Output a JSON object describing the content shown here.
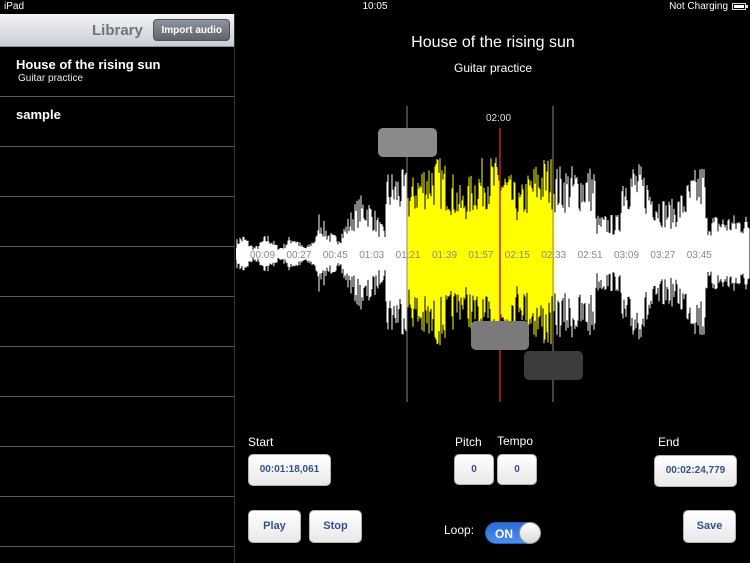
{
  "status": {
    "device": "iPad",
    "time": "10:05",
    "battery": "Not Charging"
  },
  "sidebar": {
    "title": "Library",
    "import_label": "Import audio",
    "items": [
      {
        "title": "House of the rising sun",
        "subtitle": "Guitar practice"
      },
      {
        "title": "sample",
        "subtitle": ""
      }
    ]
  },
  "song": {
    "title": "House of the rising sun",
    "subtitle": "Guitar practice"
  },
  "waveform": {
    "playhead_label": "02:00",
    "timeline_labels": [
      "00:09",
      "00:27",
      "00:45",
      "01:03",
      "01:21",
      "01:39",
      "01:57",
      "02:15",
      "02:33",
      "02:51",
      "03:09",
      "03:27",
      "03:45"
    ],
    "colors": {
      "wave": "#ffffff",
      "selection": "#ffff00",
      "playhead": "#d21f1f"
    }
  },
  "controls": {
    "start_label": "Start",
    "start_value": "00:01:18,061",
    "pitch_label": "Pitch",
    "pitch_value": "0",
    "tempo_label": "Tempo",
    "tempo_value": "0",
    "end_label": "End",
    "end_value": "00:02:24,779",
    "play_label": "Play",
    "stop_label": "Stop",
    "loop_label": "Loop:",
    "loop_state": "ON",
    "save_label": "Save"
  }
}
